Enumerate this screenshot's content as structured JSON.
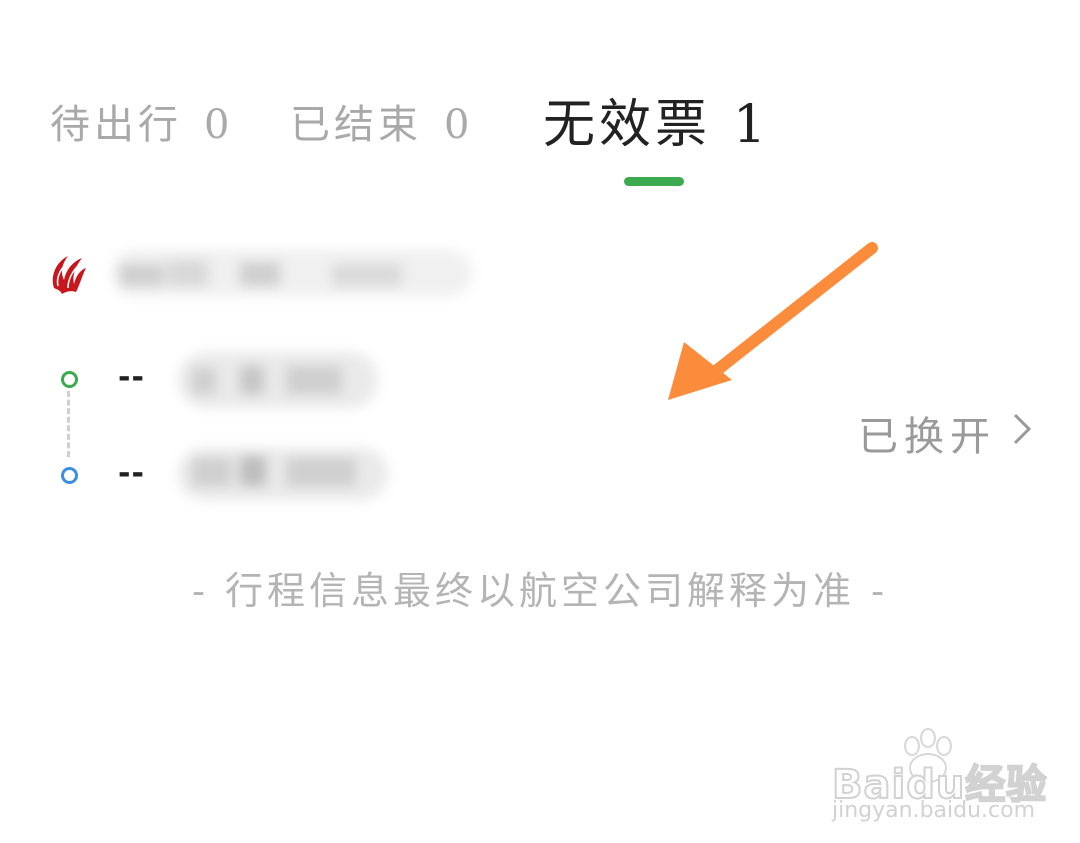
{
  "tabs": [
    {
      "label": "待出行",
      "count": "0",
      "active": false
    },
    {
      "label": "已结束",
      "count": "0",
      "active": false
    },
    {
      "label": "无效票",
      "count": "1",
      "active": true
    }
  ],
  "colors": {
    "accent_green": "#3caa4f",
    "arrival_blue": "#3b8fe0",
    "annotation_orange": "#fb8c3c",
    "airline_red": "#c8161d"
  },
  "ticket": {
    "origin_time": "--",
    "destination_time": "--",
    "status": "已换开",
    "status_icon": "chevron-right-icon",
    "airline_logo_icon": "air-china-phoenix-icon"
  },
  "footer_note": "- 行程信息最终以航空公司解释为准 -",
  "watermark": {
    "brand": "Baidu经验",
    "url": "jingyan.baidu.com"
  }
}
